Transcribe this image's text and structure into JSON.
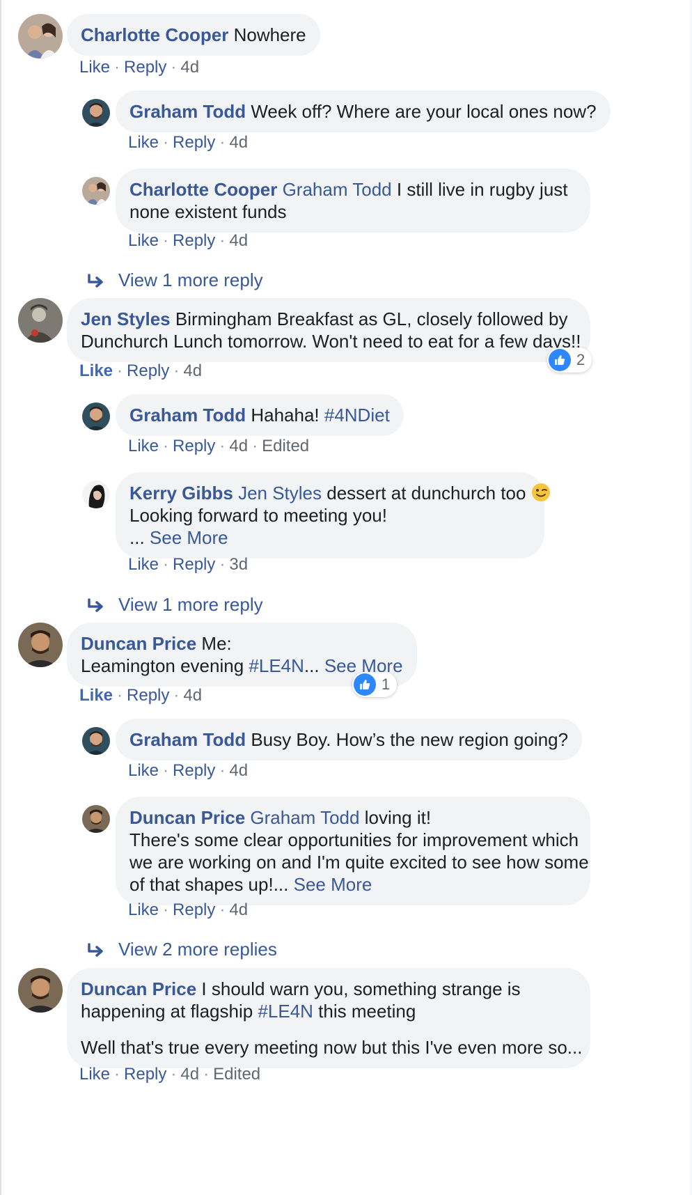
{
  "comments": [
    {
      "id": "c1",
      "author": "Charlotte Cooper",
      "text_lines": [
        "Nowhere"
      ],
      "actions": {
        "like": "Like",
        "reply": "Reply",
        "time": "4d"
      },
      "replies": [
        {
          "author": "Graham Todd",
          "text_lines": [
            "Week off? Where are your local ones now?"
          ],
          "actions": {
            "like": "Like",
            "reply": "Reply",
            "time": "4d"
          }
        },
        {
          "author": "Charlotte Cooper",
          "mention": "Graham Todd",
          "text_lines": [
            "I still live in rugby just",
            "none existent funds"
          ],
          "actions": {
            "like": "Like",
            "reply": "Reply",
            "time": "4d"
          }
        }
      ],
      "view_more": "View 1 more reply"
    },
    {
      "id": "c2",
      "author": "Jen Styles",
      "text_lines": [
        "Birmingham Breakfast as GL, closely followed by",
        "Dunchurch Lunch tomorrow. Won't need to eat for a few days!!"
      ],
      "actions": {
        "like": "Like",
        "reply": "Reply",
        "time": "4d"
      },
      "reaction_count": "2",
      "replies": [
        {
          "author": "Graham Todd",
          "text_lines": [
            "Hahaha! "
          ],
          "hashtag": "#4NDiet",
          "actions": {
            "like": "Like",
            "reply": "Reply",
            "time": "4d",
            "edited": "Edited"
          }
        },
        {
          "author": "Kerry Gibbs",
          "mention": "Jen Styles",
          "text_lines": [
            "dessert at dunchurch too",
            "Looking forward to meeting you!",
            "... "
          ],
          "see_more": "See More",
          "actions": {
            "like": "Like",
            "reply": "Reply",
            "time": "3d"
          }
        }
      ],
      "view_more": "View 1 more reply"
    },
    {
      "id": "c3",
      "author": "Duncan Price",
      "text_lines": [
        "Me:",
        "Leamington evening "
      ],
      "hashtag": "#LE4N",
      "ellipsis": "... ",
      "see_more": "See More",
      "actions": {
        "like": "Like",
        "reply": "Reply",
        "time": "4d"
      },
      "reaction_count": "1",
      "replies": [
        {
          "author": "Graham Todd",
          "text_lines": [
            "Busy Boy. How’s the new region going?"
          ],
          "actions": {
            "like": "Like",
            "reply": "Reply",
            "time": "4d"
          }
        },
        {
          "author": "Duncan Price",
          "mention": "Graham Todd",
          "text_lines": [
            "loving it!",
            "There's some clear opportunities for improvement which",
            "we are working on and I'm quite excited to see how some",
            "of that shapes up!... "
          ],
          "see_more": "See More",
          "actions": {
            "like": "Like",
            "reply": "Reply",
            "time": "4d"
          }
        }
      ],
      "view_more": "View 2 more replies"
    },
    {
      "id": "c4",
      "author": "Duncan Price",
      "text_lines": [
        "I should warn you, something strange is",
        "happening at flagship ",
        " this meeting",
        "Well that's true every meeting now but this I've even more so..."
      ],
      "hashtag": "#LE4N",
      "actions": {
        "like": "Like",
        "reply": "Reply",
        "time": "4d",
        "edited": "Edited"
      }
    }
  ],
  "icons": {
    "reply_arrow": "reply-arrow-icon",
    "like_reaction": "thumbs-up-icon",
    "emoji": "winking-face-icon"
  },
  "colors": {
    "link": "#385898",
    "bubble": "#f2f3f5",
    "like_blue": "#2d88ff"
  }
}
